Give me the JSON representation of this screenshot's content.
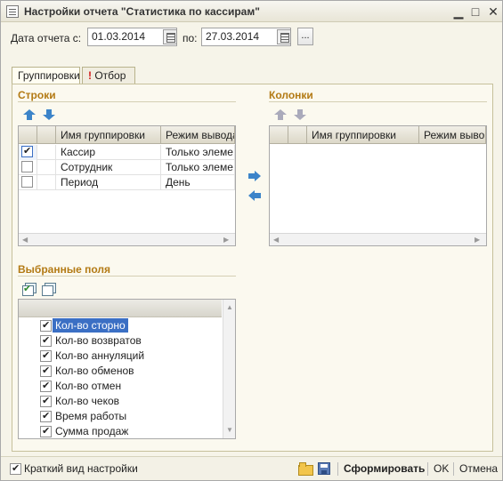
{
  "window": {
    "title": "Настройки отчета  \"Статистика по кассирам\"",
    "minimize": "▁",
    "maximize": "□",
    "close": "✕"
  },
  "dates": {
    "label_from": "Дата отчета с:",
    "from_value": "01.03.2014",
    "label_to": "по:",
    "to_value": "27.03.2014",
    "more_button": "..."
  },
  "tabs": [
    {
      "label": "Группировки"
    },
    {
      "label": "Отбор",
      "marker": "!"
    }
  ],
  "rows_section": {
    "title": "Строки",
    "columns": [
      "Имя группировки",
      "Режим вывода"
    ],
    "rows": [
      {
        "checked": true,
        "name": "Кассир",
        "mode": "Только элеме..."
      },
      {
        "checked": false,
        "name": "Сотрудник",
        "mode": "Только элеме..."
      },
      {
        "checked": false,
        "name": "Период",
        "mode": "День"
      }
    ]
  },
  "columns_section": {
    "title": "Колонки",
    "columns": [
      "Имя группировки",
      "Режим выво..."
    ]
  },
  "fields_section": {
    "title": "Выбранные поля",
    "items": [
      {
        "label": "Кол-во сторно",
        "checked": true,
        "selected": true
      },
      {
        "label": "Кол-во возвратов",
        "checked": true
      },
      {
        "label": "Кол-во аннуляций",
        "checked": true
      },
      {
        "label": "Кол-во обменов",
        "checked": true
      },
      {
        "label": "Кол-во отмен",
        "checked": true
      },
      {
        "label": "Кол-во чеков",
        "checked": true
      },
      {
        "label": "Время работы",
        "checked": true
      },
      {
        "label": "Сумма продаж",
        "checked": true
      }
    ]
  },
  "footer": {
    "short_view_label": "Краткий вид настройки",
    "short_view_checked": true,
    "generate": "Сформировать",
    "ok": "OK",
    "cancel": "Отмена"
  },
  "colors": {
    "section_title": "#b37a14",
    "accent_blue": "#3c84c9",
    "selection": "#3b6fc4"
  }
}
